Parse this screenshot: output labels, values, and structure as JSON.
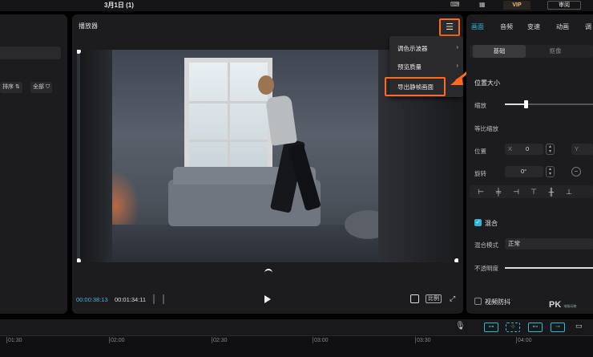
{
  "topbar": {
    "title": "3月1日 (1)",
    "vip_label": "VIP",
    "review_label": "审阅"
  },
  "left_panel": {
    "sort_label": "排序",
    "all_label": "全部"
  },
  "player": {
    "title": "播放器",
    "current_time": "00:00:38:13",
    "total_time": "00:01:34:11",
    "ratio_label": "比例",
    "menu": {
      "items": [
        {
          "label": "调色示波器",
          "has_submenu": true
        },
        {
          "label": "预览质量",
          "has_submenu": true
        },
        {
          "label": "导出静帧画面",
          "has_submenu": false
        }
      ]
    }
  },
  "inspector": {
    "tabs": [
      "画面",
      "音频",
      "变速",
      "动画",
      "调"
    ],
    "active_tab": "画面",
    "subtabs": [
      "基础",
      "抠像"
    ],
    "active_subtab": "基础",
    "position_size": {
      "title": "位置大小",
      "scale_label": "缩放",
      "scale_value": 0.24,
      "uniform_scale_label": "等比缩放",
      "position_label": "位置",
      "x_label": "X",
      "x_value": "0",
      "y_label": "Y",
      "rotate_label": "旋转",
      "rotate_value": "0°"
    },
    "blend": {
      "title": "混合",
      "enabled": true,
      "mode_label": "混合模式",
      "mode_value": "正常",
      "opacity_label": "不透明度",
      "opacity_value": 1.0
    },
    "stabilize": {
      "title": "视频防抖",
      "enabled": false
    }
  },
  "timeline": {
    "ruler_labels": [
      "01:30",
      "02:00",
      "02:30",
      "03:00",
      "03:30",
      "04:00"
    ]
  },
  "watermark": {
    "text": "PK",
    "subtext": "电脑玩物"
  },
  "colors": {
    "accent": "#2fb6d6",
    "highlight": "#ff6a1f",
    "panel": "#1c1c1e"
  }
}
